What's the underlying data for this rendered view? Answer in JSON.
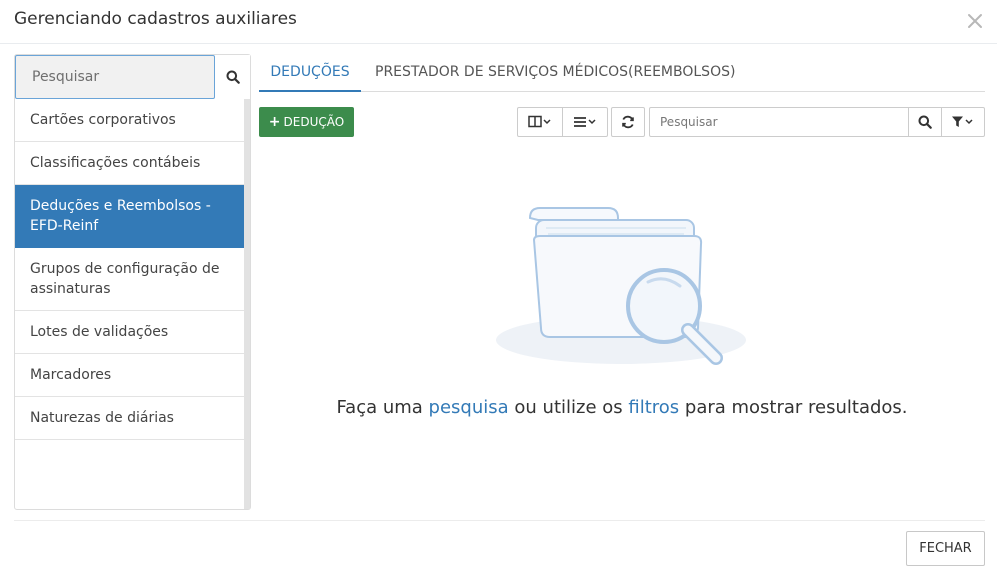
{
  "modal": {
    "title": "Gerenciando cadastros auxiliares",
    "close_button": "FECHAR"
  },
  "sidebar": {
    "search_placeholder": "Pesquisar",
    "items": [
      {
        "label": "Cartões corporativos",
        "active": false
      },
      {
        "label": "Classificações contábeis",
        "active": false
      },
      {
        "label": "Deduções e Reembolsos - EFD-Reinf",
        "active": true
      },
      {
        "label": "Grupos de configuração de assinaturas",
        "active": false
      },
      {
        "label": "Lotes de validações",
        "active": false
      },
      {
        "label": "Marcadores",
        "active": false
      },
      {
        "label": "Naturezas de diárias",
        "active": false
      }
    ]
  },
  "tabs": [
    {
      "label": "DEDUÇÕES",
      "active": true
    },
    {
      "label": "PRESTADOR DE SERVIÇOS MÉDICOS(REEMBOLSOS)",
      "active": false
    }
  ],
  "toolbar": {
    "add_label": "DEDUÇÃO",
    "search_placeholder": "Pesquisar"
  },
  "empty_state": {
    "text_before": "Faça uma ",
    "link_search": "pesquisa",
    "text_middle": " ou utilize os ",
    "link_filters": "filtros",
    "text_after": " para mostrar resultados."
  },
  "colors": {
    "primary": "#337ab7",
    "success": "#3c8c4c",
    "illustration": "#a9c6e4"
  },
  "icons": {
    "close": "close-icon",
    "search": "search-icon",
    "columns": "columns-icon",
    "list": "list-icon",
    "refresh": "refresh-icon",
    "filter": "filter-icon",
    "empty": "folder-magnifier-icon"
  }
}
